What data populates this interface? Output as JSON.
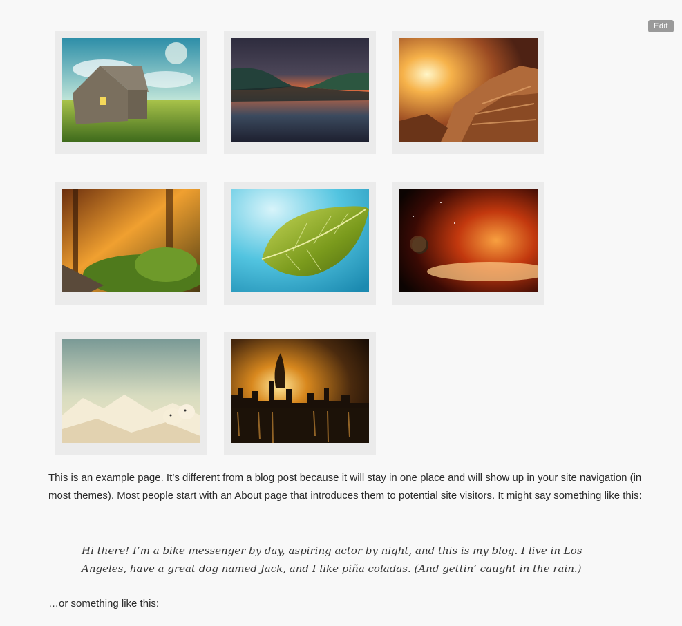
{
  "admin": {
    "edit_label": "Edit"
  },
  "gallery": {
    "items": [
      {
        "icon": "cabin-meadow-image"
      },
      {
        "icon": "lake-sunset-image"
      },
      {
        "icon": "canyon-sunrise-image"
      },
      {
        "icon": "forest-sunlight-image"
      },
      {
        "icon": "green-leaf-image"
      },
      {
        "icon": "fiery-nebula-image"
      },
      {
        "icon": "polar-bears-image"
      },
      {
        "icon": "city-skyline-night-image"
      }
    ]
  },
  "content": {
    "intro": "This is an example page. It’s different from a blog post because it will stay in one place and will show up in your site navigation (in most themes). Most people start with an About page that introduces them to potential site visitors. It might say something like this:",
    "quote": "Hi there! I’m a bike messenger by day, aspiring actor by night, and this is my blog. I live in Los Angeles, have a great dog named Jack, and I like piña coladas. (And gettin’ caught in the rain.)",
    "after": "…or something like this:"
  }
}
